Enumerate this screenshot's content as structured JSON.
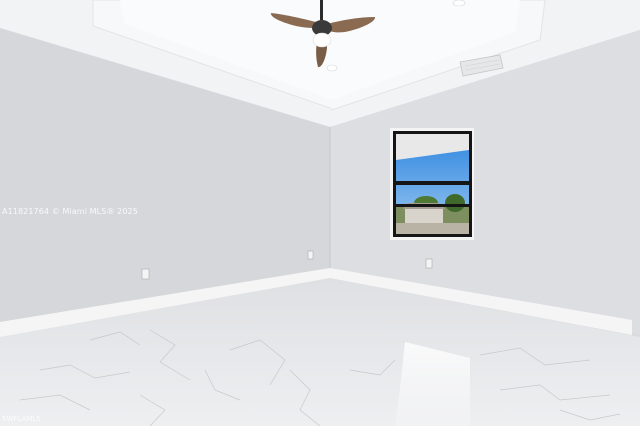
{
  "photo": {
    "subject": "empty-room",
    "colors": {
      "ceiling": "#f4f5f7",
      "wall_left": "#d5d6d9",
      "wall_right": "#dcdde0",
      "baseboard": "#f6f6f6",
      "floor": "#e6e7e9",
      "fan_blade": "#8a6b52",
      "sky": "#3d8fe0"
    },
    "watermark": "A11821764 © Miami MLS® 2025",
    "corner_mark": "SWFLAMLS"
  }
}
